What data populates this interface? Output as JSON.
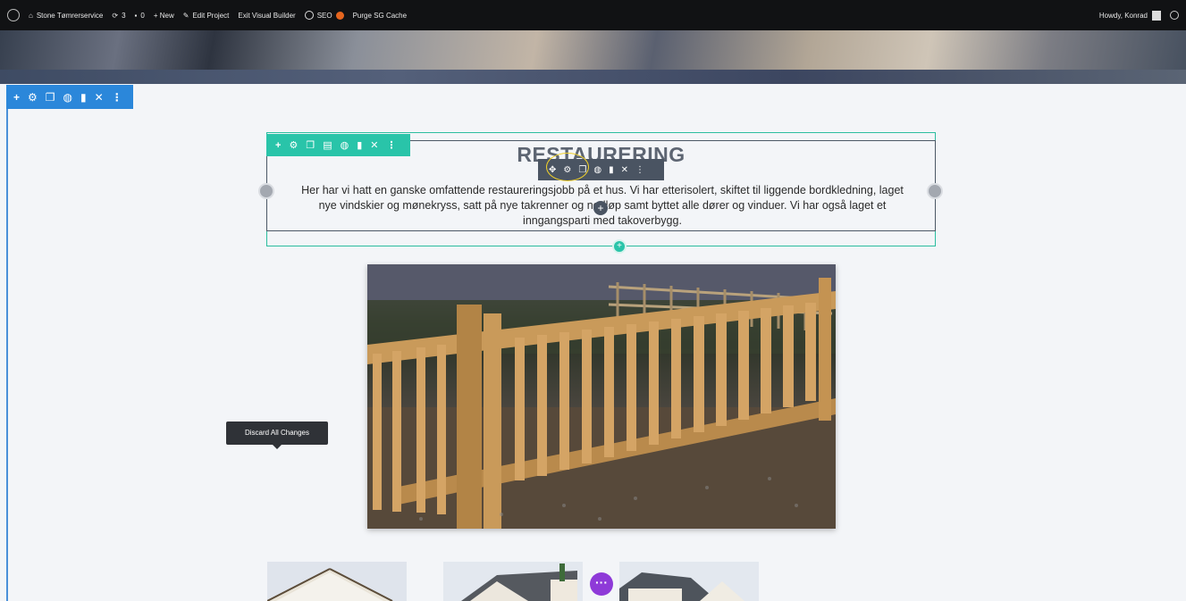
{
  "adminbar": {
    "site_name": "Stone Tømrerservice",
    "updates_count": "3",
    "comments_count": "0",
    "new_label": "+ New",
    "edit_project_label": "Edit Project",
    "exit_visual_builder_label": "Exit Visual Builder",
    "seo_label": "SEO",
    "purge_cache_label": "Purge SG Cache",
    "greeting": "Howdy, Konrad"
  },
  "section_toolbar": {
    "icons": [
      "plus-icon",
      "gear-icon",
      "duplicate-icon",
      "globe-icon",
      "trash-icon",
      "close-icon",
      "more-icon"
    ]
  },
  "row_toolbar": {
    "icons": [
      "plus-icon",
      "gear-icon",
      "duplicate-icon",
      "columns-icon",
      "globe-icon",
      "trash-icon",
      "close-icon",
      "more-icon"
    ]
  },
  "module_toolbar": {
    "icons": [
      "move-icon",
      "gear-icon",
      "duplicate-icon",
      "globe-icon",
      "trash-icon",
      "close-icon",
      "more-icon"
    ]
  },
  "content": {
    "heading": "RESTAURERING",
    "body": "Her har vi hatt en ganske omfattende restaureringsjobb på et hus. Vi har etterisolert, skiftet til liggende bordkledning, laget nye vindskier og mønekryss, satt på nye takrenner og nedløp samt byttet alle dører og vinduer. Vi har også laget et inngangsparti med takoverbygg."
  },
  "tooltip": {
    "label": "Discard All Changes"
  },
  "colors": {
    "section_blue": "#2b87da",
    "row_green": "#29c4a9",
    "module_dark": "#4a5462",
    "highlight_yellow": "#f1d12a",
    "purple": "#8e3ad8"
  }
}
